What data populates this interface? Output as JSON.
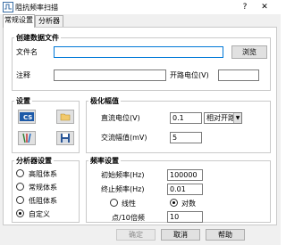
{
  "window": {
    "title": "阻抗频率扫描",
    "help": "?",
    "close": "✕"
  },
  "tabs": [
    {
      "label": "常规设置"
    },
    {
      "label": "分析器"
    }
  ],
  "create_file": {
    "group_title": "创建数据文件",
    "filename_label": "文件名",
    "filename_value": "",
    "browse_label": "浏览",
    "note_label": "注释",
    "note_value": "",
    "start_potential_label": "开路电位(V)",
    "start_potential_value": ""
  },
  "settings": {
    "group_title": "设置"
  },
  "polarization": {
    "group_title": "极化幅值",
    "dc_label": "直流电位(V)",
    "dc_value": "0.1",
    "dc_mode": "相对开路",
    "ac_label": "交流幅值(mV)",
    "ac_value": "5"
  },
  "analyzer": {
    "group_title": "分析器设置",
    "options": [
      {
        "label": "高阻体系",
        "selected": false
      },
      {
        "label": "常规体系",
        "selected": false
      },
      {
        "label": "低阻体系",
        "selected": false
      },
      {
        "label": "自定义",
        "selected": true
      }
    ]
  },
  "frequency": {
    "group_title": "频率设置",
    "init_label": "初始频率(Hz)",
    "init_value": "100000",
    "final_label": "终止频率(Hz)",
    "final_value": "0.01",
    "linear_label": "线性",
    "log_label": "对数",
    "scale": "log",
    "points_label": "点/10倍频",
    "points_value": "10"
  },
  "buttons": {
    "ok": "确定",
    "cancel": "取消",
    "help": "帮助"
  }
}
